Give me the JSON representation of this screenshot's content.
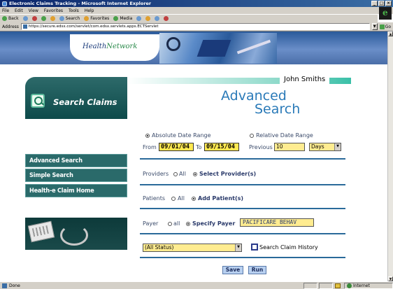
{
  "browser": {
    "title": "Electronic Claims Tracking - Microsoft Internet Explorer",
    "window_buttons": [
      "_",
      "□",
      "×"
    ],
    "menu": [
      "File",
      "Edit",
      "View",
      "Favorites",
      "Tools",
      "Help"
    ],
    "toolbar": {
      "back": "Back",
      "search": "Search",
      "favorites": "Favorites",
      "media": "Media"
    },
    "address_label": "Address",
    "url": "https://secure.edsx.com/servlet/com.edsx.servlets.apps.ECTServlet",
    "go_label": "Go",
    "status": "Done",
    "zone": "Internet"
  },
  "banner": {
    "logo_part1": "Health",
    "logo_part2": "Network"
  },
  "sidebar": {
    "title": "Search Claims",
    "items": [
      {
        "label": "Advanced Search"
      },
      {
        "label": "Simple Search"
      },
      {
        "label": "Health-e Claim Home"
      }
    ]
  },
  "header": {
    "user_name": "John Smiths",
    "title_line1": "Advanced",
    "title_line2": "Search"
  },
  "form": {
    "date": {
      "absolute_label": "Absolute Date Range",
      "relative_label": "Relative Date Range",
      "from_label": "From",
      "from_value": "09/01/04",
      "to_label": "To",
      "to_value": "09/15/04",
      "previous_label": "Previous",
      "previous_value": "10",
      "unit_value": "Days"
    },
    "providers": {
      "label": "Providers",
      "all_label": "All",
      "select_label": "Select Provider(s)"
    },
    "patients": {
      "label": "Patients",
      "all_label": "All",
      "add_label": "Add Patient(s)"
    },
    "payer": {
      "label": "Payer",
      "all_label": "all",
      "specify_label": "Specify Payer",
      "value": "PACIFICARE BEHAV"
    },
    "status_value": "(All Status)",
    "history_label": "Search Claim History",
    "save_label": "Save",
    "run_label": "Run"
  }
}
